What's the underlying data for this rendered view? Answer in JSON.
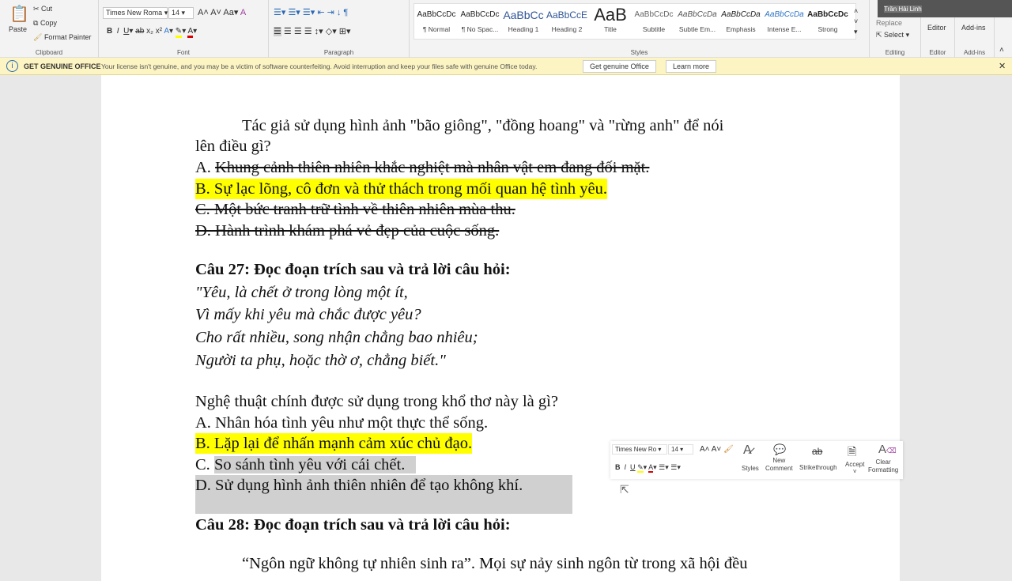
{
  "ribbon": {
    "clipboard": {
      "paste": "Paste",
      "cut": "Cut",
      "copy": "Copy",
      "format_painter": "Format Painter",
      "label": "Clipboard"
    },
    "font": {
      "name": "Times New Roma",
      "size": "14",
      "label": "Font"
    },
    "paragraph": {
      "label": "Paragraph"
    },
    "styles": {
      "label": "Styles",
      "items": [
        {
          "preview": "AaBbCcDc",
          "name": "¶ Normal"
        },
        {
          "preview": "AaBbCcDc",
          "name": "¶ No Spac..."
        },
        {
          "preview": "AaBbCc",
          "name": "Heading 1"
        },
        {
          "preview": "AaBbCcE",
          "name": "Heading 2"
        },
        {
          "preview": "AaB",
          "name": "Title"
        },
        {
          "preview": "AaBbCcDc",
          "name": "Subtitle"
        },
        {
          "preview": "AaBbCcDa",
          "name": "Subtle Em..."
        },
        {
          "preview": "AaBbCcDa",
          "name": "Emphasis"
        },
        {
          "preview": "AaBbCcDa",
          "name": "Intense E..."
        },
        {
          "preview": "AaBbCcDc",
          "name": "Strong"
        }
      ]
    },
    "editing": {
      "replace": "Replace",
      "select": "Select",
      "label": "Editing"
    },
    "editor": {
      "button": "Editor",
      "label": "Editor"
    },
    "addins": {
      "button": "Add-ins",
      "label": "Add-ins"
    },
    "webcam_name": "Trần Hải Linh"
  },
  "banner": {
    "title": "GET GENUINE OFFICE",
    "message": "Your license isn't genuine, and you may be a victim of software counterfeiting. Avoid interruption and keep your files safe with genuine Office today.",
    "get_button": "Get genuine Office",
    "learn_button": "Learn more"
  },
  "doc": {
    "q26_line1": "Tác giả sử dụng hình ảnh \"bão giông\", \"đồng hoang\" và \"rừng anh\" để nói",
    "q26_line2": "lên điều gì?",
    "q26_a_prefix": "A. ",
    "q26_a": "Khung cảnh thiên nhiên khắc nghiệt mà nhân vật em đang đối mặt.",
    "q26_b": "B. Sự lạc lõng, cô đơn và thử thách trong mối quan hệ tình yêu.",
    "q26_c": "C. Một bức tranh trữ tình về thiên nhiên mùa thu.",
    "q26_d": "D. Hành trình khám phá vẻ đẹp của cuộc sống.",
    "q27_title": "Câu 27: Đọc đoạn trích sau và trả lời câu hỏi:",
    "poem": [
      "\"Yêu, là chết ở trong lòng một ít,",
      "Vì mấy khi yêu mà chắc được yêu?",
      "Cho rất nhiều, song nhận chẳng bao nhiêu;",
      "Người ta phụ, hoặc thờ ơ, chẳng biết.\""
    ],
    "q27_question": "Nghệ thuật chính được sử dụng trong khổ thơ này là gì?",
    "q27_a": "A. Nhân hóa tình yêu như một thực thể sống.",
    "q27_b": "B. Lặp lại để nhấn mạnh cảm xúc chủ đạo.",
    "q27_c_prefix": "C. ",
    "q27_c": "So sánh tình yêu với cái chết.",
    "q27_d": "D. Sử dụng hình ảnh thiên nhiên để tạo không khí.",
    "q28_title": "Câu 28: Đọc đoạn trích sau và trả lời câu hỏi:",
    "q28_line1": "“Ngôn ngữ không tự nhiên sinh ra”. Mọi sự nảy sinh ngôn từ trong xã hội đều"
  },
  "mini_toolbar": {
    "font": "Times New Ro",
    "size": "14",
    "styles": "Styles",
    "new_comment_1": "New",
    "new_comment_2": "Comment",
    "strikethrough": "Strikethrough",
    "accept": "Accept",
    "clear_1": "Clear",
    "clear_2": "Formatting"
  },
  "colors": {
    "highlight": "#ffff00",
    "banner": "#fcf4c2"
  }
}
